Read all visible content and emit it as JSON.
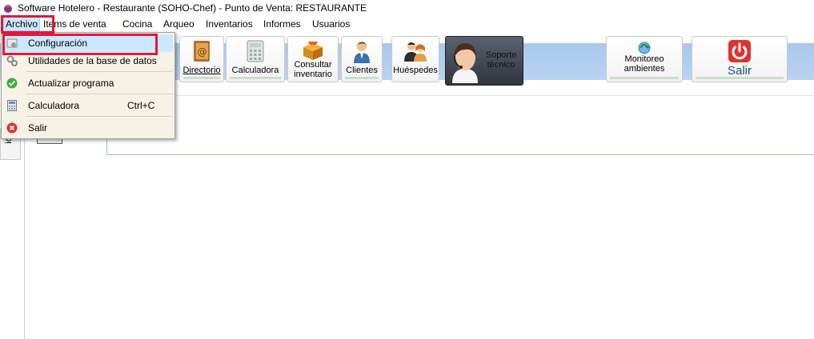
{
  "window": {
    "title": "Software  Hotelero - Restaurante (SOHO-Chef)  - Punto de Venta: RESTAURANTE"
  },
  "menubar": {
    "items": [
      "Archivo",
      "Items de venta",
      "Cocina",
      "Arqueo",
      "Inventarios",
      "Informes",
      "Usuarios"
    ]
  },
  "toolbar": {
    "directorio": "Directorio",
    "calculadora": "Calculadora",
    "consultar_1": "Consultar",
    "consultar_2": "inventario",
    "clientes": "Clientes",
    "huespedes": "Huéspedes",
    "soporte_1": "Soporte",
    "soporte_2": "técnico",
    "monitoreo_1": "Monitoreo",
    "monitoreo_2": "ambientes",
    "salir": "Salir"
  },
  "archivo_menu": {
    "items": [
      {
        "label": "Configuración",
        "icon": "config-icon",
        "shortcut": ""
      },
      {
        "label": "Utilidades de la base de datos",
        "icon": "gears-icon",
        "shortcut": ""
      },
      {
        "label": "Actualizar programa",
        "icon": "check-icon",
        "shortcut": ""
      },
      {
        "label": "Calculadora",
        "icon": "calculator-icon",
        "shortcut": "Ctrl+C"
      },
      {
        "label": "Salir",
        "icon": "exit-icon",
        "shortcut": ""
      }
    ]
  },
  "side_tab": {
    "label": "ión"
  },
  "colors": {
    "highlight": "#e0193b",
    "menu_hover": "#cce8ff",
    "toolbar_band": "#b0cdef"
  }
}
